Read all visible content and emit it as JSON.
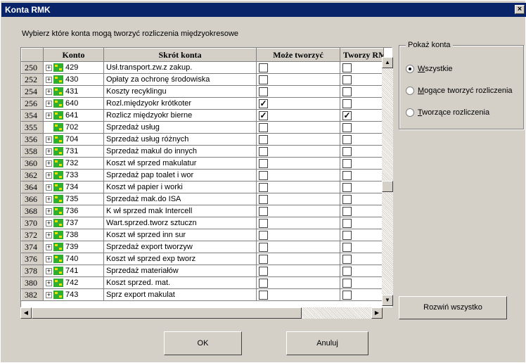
{
  "window": {
    "title": "Konta RMK",
    "close_glyph": "×"
  },
  "instruction": "Wybierz które konta mogą tworzyć rozliczenia międzyokresowe",
  "table": {
    "columns": [
      "",
      "Konto",
      "Skrót konta",
      "Może tworzyć",
      "Tworzy RM"
    ],
    "rows": [
      {
        "num": "250",
        "konto": "429",
        "name": "Usł.transport.zw.z zakup.",
        "moze": false,
        "tworzy": false,
        "expand": true
      },
      {
        "num": "252",
        "konto": "430",
        "name": "Opłaty za ochronę środowiska",
        "moze": false,
        "tworzy": false,
        "expand": true
      },
      {
        "num": "254",
        "konto": "431",
        "name": "Koszty recyklingu",
        "moze": false,
        "tworzy": false,
        "expand": true
      },
      {
        "num": "256",
        "konto": "640",
        "name": "Rozl.międzyokr krótkoter",
        "moze": true,
        "tworzy": false,
        "expand": true
      },
      {
        "num": "354",
        "konto": "641",
        "name": "Rozlicz międzyokr bierne",
        "moze": true,
        "tworzy": true,
        "expand": true
      },
      {
        "num": "355",
        "konto": "702",
        "name": "Sprzedaż usług",
        "moze": false,
        "tworzy": false,
        "expand": false
      },
      {
        "num": "356",
        "konto": "704",
        "name": "Sprzedaż usług różnych",
        "moze": false,
        "tworzy": false,
        "expand": true
      },
      {
        "num": "358",
        "konto": "731",
        "name": "Sprzedaż makul do innych",
        "moze": false,
        "tworzy": false,
        "expand": true
      },
      {
        "num": "360",
        "konto": "732",
        "name": "Koszt wł sprzed makulatur",
        "moze": false,
        "tworzy": false,
        "expand": true
      },
      {
        "num": "362",
        "konto": "733",
        "name": "Sprzedaż pap toalet i wor",
        "moze": false,
        "tworzy": false,
        "expand": true
      },
      {
        "num": "364",
        "konto": "734",
        "name": "Koszt wł papier i worki",
        "moze": false,
        "tworzy": false,
        "expand": true
      },
      {
        "num": "366",
        "konto": "735",
        "name": "Sprzedaż mak.do ISA",
        "moze": false,
        "tworzy": false,
        "expand": true
      },
      {
        "num": "368",
        "konto": "736",
        "name": "K wł sprzed mak Intercell",
        "moze": false,
        "tworzy": false,
        "expand": true
      },
      {
        "num": "370",
        "konto": "737",
        "name": "Wart.sprzed.tworz sztuczn",
        "moze": false,
        "tworzy": false,
        "expand": true
      },
      {
        "num": "372",
        "konto": "738",
        "name": "Koszt wł sprzed inn sur",
        "moze": false,
        "tworzy": false,
        "expand": true
      },
      {
        "num": "374",
        "konto": "739",
        "name": "Sprzedaż export tworzyw",
        "moze": false,
        "tworzy": false,
        "expand": true
      },
      {
        "num": "376",
        "konto": "740",
        "name": "Koszt wł sprzed exp tworz",
        "moze": false,
        "tworzy": false,
        "expand": true
      },
      {
        "num": "378",
        "konto": "741",
        "name": "Sprzedaż materiałów",
        "moze": false,
        "tworzy": false,
        "expand": true
      },
      {
        "num": "380",
        "konto": "742",
        "name": "Koszt sprzed. mat.",
        "moze": false,
        "tworzy": false,
        "expand": true
      },
      {
        "num": "382",
        "konto": "743",
        "name": "Sprz export makulat",
        "moze": false,
        "tworzy": false,
        "expand": true
      }
    ],
    "check_glyph": "✓"
  },
  "filter": {
    "legend": "Pokaż konta",
    "options": [
      {
        "access": "W",
        "rest": "szystkie",
        "selected": true
      },
      {
        "access": "M",
        "rest": "ogące tworzyć rozliczenia",
        "selected": false
      },
      {
        "access": "T",
        "rest": "worzące rozliczenia",
        "selected": false
      }
    ]
  },
  "buttons": {
    "expand_all": "Rozwiń wszystko",
    "ok": "OK",
    "cancel": "Anuluj"
  },
  "icons": {
    "expand": "expand-plus-icon",
    "account": "account-tree-icon",
    "up": "▲",
    "down": "▼",
    "left": "◀",
    "right": "▶"
  }
}
